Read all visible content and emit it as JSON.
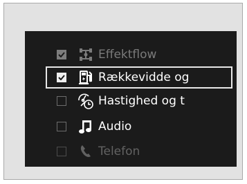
{
  "menu": {
    "items": [
      {
        "label": "Effektflow",
        "icon": "drivetrain-icon",
        "checked": true,
        "state": "disabled"
      },
      {
        "label": "Rækkevidde og",
        "icon": "fuel-pump-icon",
        "checked": true,
        "state": "selected"
      },
      {
        "label": "Hastighed og t",
        "icon": "speedometer-clock-icon",
        "checked": false,
        "state": "normal"
      },
      {
        "label": "Audio",
        "icon": "music-note-icon",
        "checked": false,
        "state": "normal"
      },
      {
        "label": "Telefon",
        "icon": "phone-icon",
        "checked": false,
        "state": "partially-visible"
      }
    ]
  },
  "colors": {
    "background": "#e2e2e2",
    "screen": "#1b1b1b",
    "text": "#ffffff",
    "disabled_text": "#7a7a7a",
    "highlight_border": "#e8e8e8"
  }
}
